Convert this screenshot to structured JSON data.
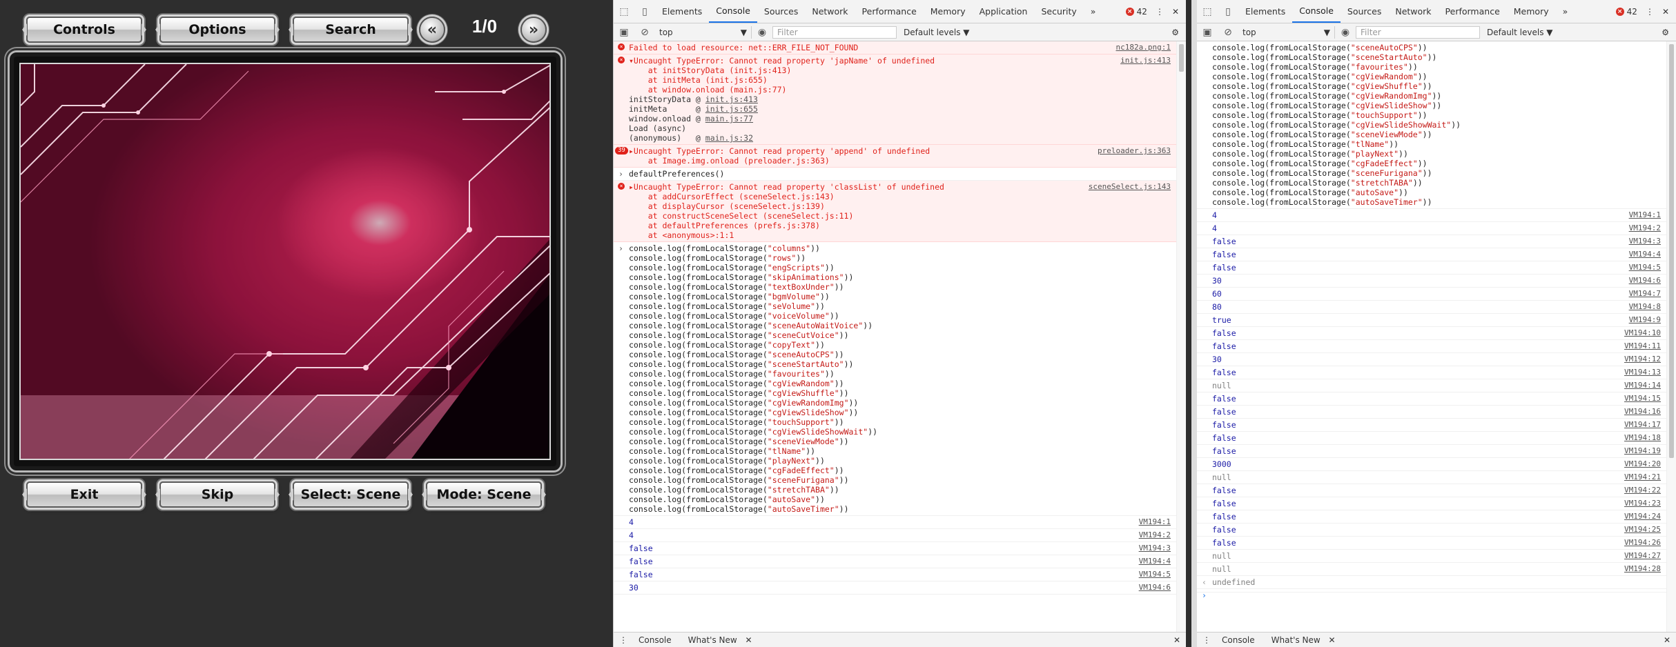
{
  "game": {
    "top_buttons": [
      "Controls",
      "Options",
      "Search"
    ],
    "prev_icon": "double-chevron-left-icon",
    "next_icon": "double-chevron-right-icon",
    "page_count": "1/0",
    "bottom_buttons": [
      "Exit",
      "Skip",
      "Select: Scene",
      "Mode: Scene"
    ]
  },
  "devtools_left": {
    "tabs": [
      "Elements",
      "Console",
      "Sources",
      "Network",
      "Performance",
      "Memory",
      "Application",
      "Security"
    ],
    "more_tabs": "»",
    "error_count": "42",
    "context": "top",
    "filter_placeholder": "Filter",
    "levels": "Default levels ▼",
    "drawer_tabs": [
      "Console",
      "What's New"
    ],
    "messages": [
      {
        "type": "error",
        "text": "Failed to load resource: net::ERR_FILE_NOT_FOUND",
        "src": "nc182a.png:1"
      },
      {
        "type": "error",
        "text": "▾Uncaught TypeError: Cannot read property 'japName' of undefined",
        "src": "init.js:413",
        "stack": [
          "    at initStoryData (init.js:413)",
          "    at initMeta (init.js:655)",
          "    at window.onload (main.js:77)"
        ],
        "trace": [
          [
            "initStoryData @ ",
            "init.js:413"
          ],
          [
            "initMeta      @ ",
            "init.js:655"
          ],
          [
            "window.onload @ ",
            "main.js:77"
          ],
          [
            "Load (async)",
            ""
          ],
          [
            "(anonymous)   @ ",
            "main.js:32"
          ]
        ]
      },
      {
        "type": "error",
        "badge": "39",
        "text": "▸Uncaught TypeError: Cannot read property 'append' of undefined",
        "src": "preloader.js:363",
        "stack": [
          "    at Image.img.onload (preloader.js:363)"
        ]
      },
      {
        "type": "cmd",
        "text": "defaultPreferences()"
      },
      {
        "type": "error",
        "text": "▸Uncaught TypeError: Cannot read property 'classList' of undefined",
        "src": "sceneSelect.js:143",
        "stack": [
          "    at addCursorEffect (sceneSelect.js:143)",
          "    at displayCursor (sceneSelect.js:139)",
          "    at constructSceneSelect (sceneSelect.js:11)",
          "    at defaultPreferences (prefs.js:378)",
          "    at <anonymous>:1:1"
        ]
      }
    ],
    "log_keys": [
      "columns",
      "rows",
      "engScripts",
      "skipAnimations",
      "textBoxUnder",
      "bgmVolume",
      "seVolume",
      "voiceVolume",
      "sceneAutoWaitVoice",
      "sceneCutVoice",
      "copyText",
      "sceneAutoCPS",
      "sceneStartAuto",
      "favourites",
      "cgViewRandom",
      "cgViewShuffle",
      "cgViewRandomImg",
      "cgViewSlideShow",
      "touchSupport",
      "cgViewSlideShowWait",
      "sceneViewMode",
      "tlName",
      "playNext",
      "cgFadeEffect",
      "sceneFurigana",
      "stretchTABA",
      "autoSave",
      "autoSaveTimer"
    ],
    "results": [
      {
        "v": "4",
        "src": "VM194:1"
      },
      {
        "v": "4",
        "src": "VM194:2"
      },
      {
        "v": "false",
        "src": "VM194:3"
      },
      {
        "v": "false",
        "src": "VM194:4"
      },
      {
        "v": "false",
        "src": "VM194:5"
      },
      {
        "v": "30",
        "src": "VM194:6"
      }
    ]
  },
  "devtools_right": {
    "tabs": [
      "Elements",
      "Console",
      "Sources",
      "Network",
      "Performance",
      "Memory"
    ],
    "more_tabs": "»",
    "error_count": "42",
    "context": "top",
    "filter_placeholder": "Filter",
    "levels": "Default levels ▼",
    "drawer_tabs": [
      "Console",
      "What's New"
    ],
    "log_keys_visible": [
      "sceneAutoCPS",
      "sceneStartAuto",
      "favourites",
      "cgViewRandom",
      "cgViewShuffle",
      "cgViewRandomImg",
      "cgViewSlideShow",
      "touchSupport",
      "cgViewSlideShowWait",
      "sceneViewMode",
      "tlName",
      "playNext",
      "cgFadeEffect",
      "sceneFurigana",
      "stretchTABA",
      "autoSave",
      "autoSaveTimer"
    ],
    "results": [
      {
        "v": "4",
        "src": "VM194:1"
      },
      {
        "v": "4",
        "src": "VM194:2"
      },
      {
        "v": "false",
        "src": "VM194:3"
      },
      {
        "v": "false",
        "src": "VM194:4"
      },
      {
        "v": "false",
        "src": "VM194:5"
      },
      {
        "v": "30",
        "src": "VM194:6"
      },
      {
        "v": "60",
        "src": "VM194:7"
      },
      {
        "v": "80",
        "src": "VM194:8"
      },
      {
        "v": "true",
        "src": "VM194:9"
      },
      {
        "v": "false",
        "src": "VM194:10"
      },
      {
        "v": "false",
        "src": "VM194:11"
      },
      {
        "v": "30",
        "src": "VM194:12"
      },
      {
        "v": "false",
        "src": "VM194:13"
      },
      {
        "v": "null",
        "src": "VM194:14"
      },
      {
        "v": "false",
        "src": "VM194:15"
      },
      {
        "v": "false",
        "src": "VM194:16"
      },
      {
        "v": "false",
        "src": "VM194:17"
      },
      {
        "v": "false",
        "src": "VM194:18"
      },
      {
        "v": "false",
        "src": "VM194:19"
      },
      {
        "v": "3000",
        "src": "VM194:20"
      },
      {
        "v": "null",
        "src": "VM194:21"
      },
      {
        "v": "false",
        "src": "VM194:22"
      },
      {
        "v": "false",
        "src": "VM194:23"
      },
      {
        "v": "false",
        "src": "VM194:24"
      },
      {
        "v": "false",
        "src": "VM194:25"
      },
      {
        "v": "false",
        "src": "VM194:26"
      },
      {
        "v": "null",
        "src": "VM194:27"
      },
      {
        "v": "null",
        "src": "VM194:28"
      }
    ],
    "final_result": "undefined"
  },
  "colors": {
    "error_red": "#e0221b",
    "accent_blue": "#1a73e8",
    "scene_pink": "#e0285f"
  }
}
